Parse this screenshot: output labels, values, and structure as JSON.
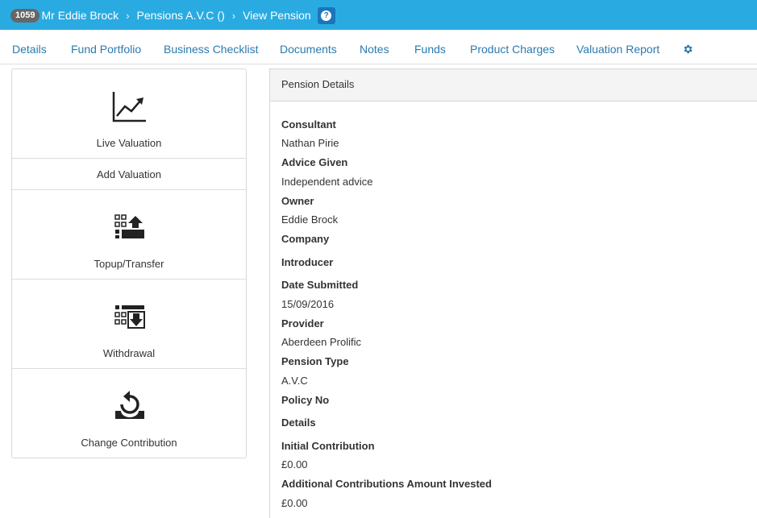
{
  "breadcrumb": {
    "client_id": "1059",
    "client_name": "Mr Eddie Brock",
    "section": "Pensions A.V.C ()",
    "page": "View Pension",
    "separator": "›",
    "help_symbol": "?"
  },
  "tabs": [
    "Details",
    "Fund Portfolio",
    "Business Checklist",
    "Documents",
    "Notes",
    "Funds",
    "Product Charges",
    "Valuation Report"
  ],
  "actions": [
    {
      "label": "Live Valuation",
      "icon": "chart-line-icon"
    },
    {
      "label": "Add Valuation",
      "icon": ""
    },
    {
      "label": "Topup/Transfer",
      "icon": "topup-transfer-icon"
    },
    {
      "label": "Withdrawal",
      "icon": "withdrawal-icon"
    },
    {
      "label": "Change Contribution",
      "icon": "change-contribution-icon"
    }
  ],
  "panel": {
    "title": "Pension Details",
    "consultant_label": "Consultant",
    "consultant_value": "Nathan Pirie",
    "advice_label": "Advice Given",
    "advice_value": "Independent advice",
    "owner_label": "Owner",
    "owner_value": "Eddie Brock",
    "company_label": "Company",
    "introducer_label": "Introducer",
    "date_label": "Date Submitted",
    "date_value": "15/09/2016",
    "provider_label": "Provider",
    "provider_value": "Aberdeen Prolific",
    "type_label": "Pension Type",
    "type_value": "A.V.C",
    "policy_label": "Policy No",
    "details_label": "Details",
    "initial_label": "Initial Contribution",
    "initial_value": "£0.00",
    "additional_label": "Additional Contributions Amount Invested",
    "additional_value": "£0.00"
  },
  "colors": {
    "topbar": "#29abe2",
    "tab_link": "#2a7ab0",
    "help_button": "#1b75bb",
    "badge": "#666666"
  }
}
